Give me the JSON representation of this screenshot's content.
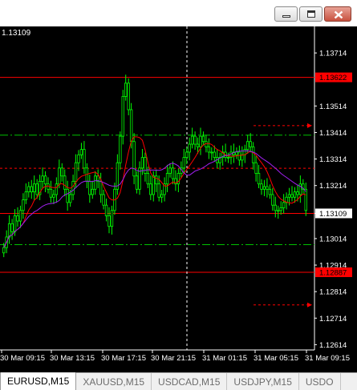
{
  "window": {
    "buttons": {
      "minimize": "minimize-icon",
      "maximize": "maximize-icon",
      "close": "close-icon"
    }
  },
  "chart": {
    "symbol_price_label": "1.13109",
    "colors": {
      "background": "#000000",
      "candle": "#00ff00",
      "ma_fast": "#ff0000",
      "ma_slow": "#a020f0",
      "level_line": "#ff0000",
      "dashdot_line": "#00c000",
      "axis_text": "#ffffff",
      "price_badge": "#ff0000",
      "crosshair": "#ffffff"
    },
    "price_axis": [
      "1.13714",
      "1.13514",
      "1.13414",
      "1.13314",
      "1.13214",
      "1.13109",
      "1.13014",
      "1.12914",
      "1.12814",
      "1.12714",
      "1.12614"
    ],
    "time_axis": [
      "30 Mar 09:15",
      "30 Mar 13:15",
      "30 Mar 17:15",
      "30 Mar 21:15",
      "31 Mar 01:15",
      "31 Mar 05:15",
      "31 Mar 09:15"
    ],
    "red_badges": [
      {
        "text": "1.13622",
        "price": 1.13622
      },
      {
        "text": "1.12887",
        "price": 1.12887
      }
    ],
    "current_price_badge": {
      "text": "1.13109",
      "price": 1.13109
    },
    "horizontal_levels": {
      "red_solid": [
        1.13622,
        1.13109,
        1.12887
      ],
      "red_dashed": [
        1.13279
      ],
      "green_dashdot": [
        1.13404,
        1.12991
      ]
    },
    "arrows_prices": [
      1.1344,
      1.12764
    ]
  },
  "chart_data": {
    "type": "candlestick",
    "price_range": [
      1.12594,
      1.13814
    ],
    "series": [
      {
        "name": "",
        "values": [
          1.1298,
          1.1302,
          1.1307,
          1.1304,
          1.131,
          1.1308,
          1.1312,
          1.1316,
          1.1319,
          1.1321,
          1.1319,
          1.1322,
          1.1318,
          1.1323,
          1.1325,
          1.1322,
          1.132,
          1.1317,
          1.1318,
          1.1322,
          1.1328,
          1.1325,
          1.132,
          1.1315,
          1.1318,
          1.1323,
          1.133,
          1.1333,
          1.1335,
          1.1328,
          1.1323,
          1.1318,
          1.132,
          1.1325,
          1.1323,
          1.1318,
          1.1314,
          1.131,
          1.1306,
          1.1312,
          1.132,
          1.133,
          1.134,
          1.1355,
          1.136,
          1.135,
          1.1338,
          1.1325,
          1.132,
          1.1328,
          1.1332,
          1.1326,
          1.1322,
          1.1318,
          1.1325,
          1.1322,
          1.1317,
          1.1318,
          1.1322,
          1.1326,
          1.1328,
          1.1324,
          1.1322,
          1.1326,
          1.1328,
          1.1332,
          1.1334,
          1.1337,
          1.134,
          1.1337,
          1.1336,
          1.134,
          1.1338,
          1.1336,
          1.1334,
          1.1334,
          1.1332,
          1.133,
          1.1332,
          1.1334,
          1.1332,
          1.1332,
          1.1334,
          1.1333,
          1.1334,
          1.1331,
          1.1333,
          1.1335,
          1.1338,
          1.1336,
          1.133,
          1.1326,
          1.1322,
          1.132,
          1.1321,
          1.132,
          1.1318,
          1.1314,
          1.1312,
          1.1312,
          1.1313,
          1.1315,
          1.1317,
          1.1318,
          1.1317,
          1.1319,
          1.1318,
          1.1322,
          1.132,
          1.1312
        ]
      }
    ]
  }
}
